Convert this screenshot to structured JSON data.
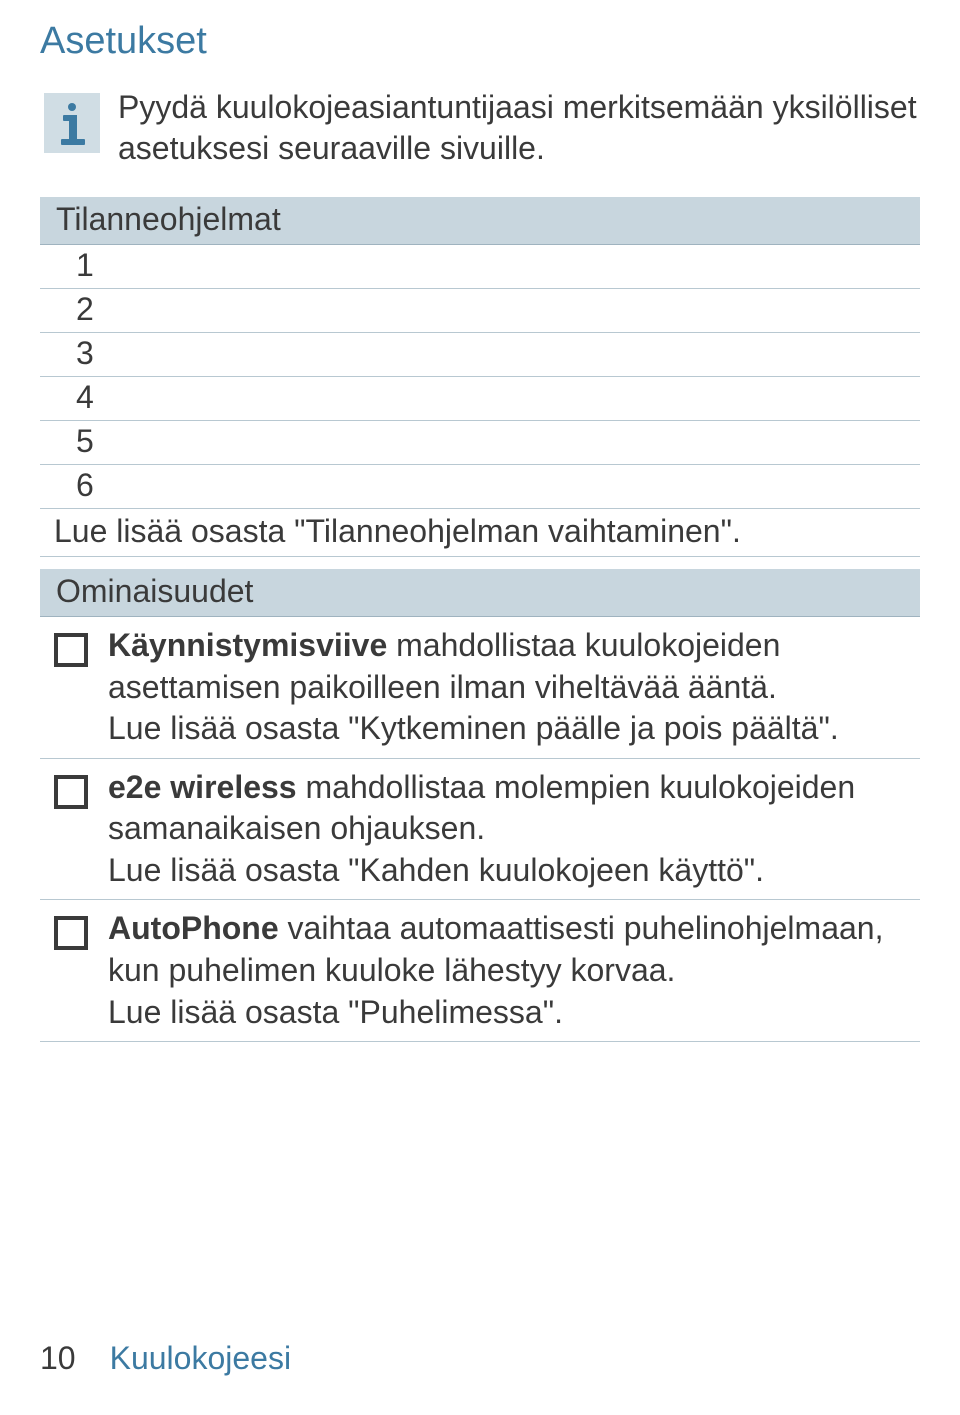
{
  "heading": "Asetukset",
  "info_text": "Pyydä kuulokojeasiantuntijaasi merkitsemään yksilölliset asetuksesi seuraaville sivuille.",
  "programs": {
    "header": "Tilanneohjelmat",
    "rows": [
      "1",
      "2",
      "3",
      "4",
      "5",
      "6"
    ],
    "note": "Lue lisää osasta \"Tilanneohjelman vaihtaminen\"."
  },
  "features": {
    "header": "Ominaisuudet",
    "items": [
      {
        "bold": "Käynnistymisviive",
        "rest": " mahdollistaa kuulokojeiden asettamisen paikoilleen ilman viheltävää ääntä.",
        "more": "Lue lisää osasta \"Kytkeminen päälle ja pois päältä\"."
      },
      {
        "bold": "e2e wireless",
        "rest": " mahdollistaa molempien kuulokojeiden samanaikaisen ohjauksen.",
        "more": "Lue lisää osasta \"Kahden kuulokojeen käyttö\"."
      },
      {
        "bold": "AutoPhone",
        "rest": " vaihtaa automaattisesti puhelinohjelmaan, kun puhelimen kuuloke lähestyy korvaa.",
        "more": "Lue lisää osasta \"Puhelimessa\"."
      }
    ]
  },
  "footer": {
    "page": "10",
    "crumb": "Kuulokojeesi"
  }
}
